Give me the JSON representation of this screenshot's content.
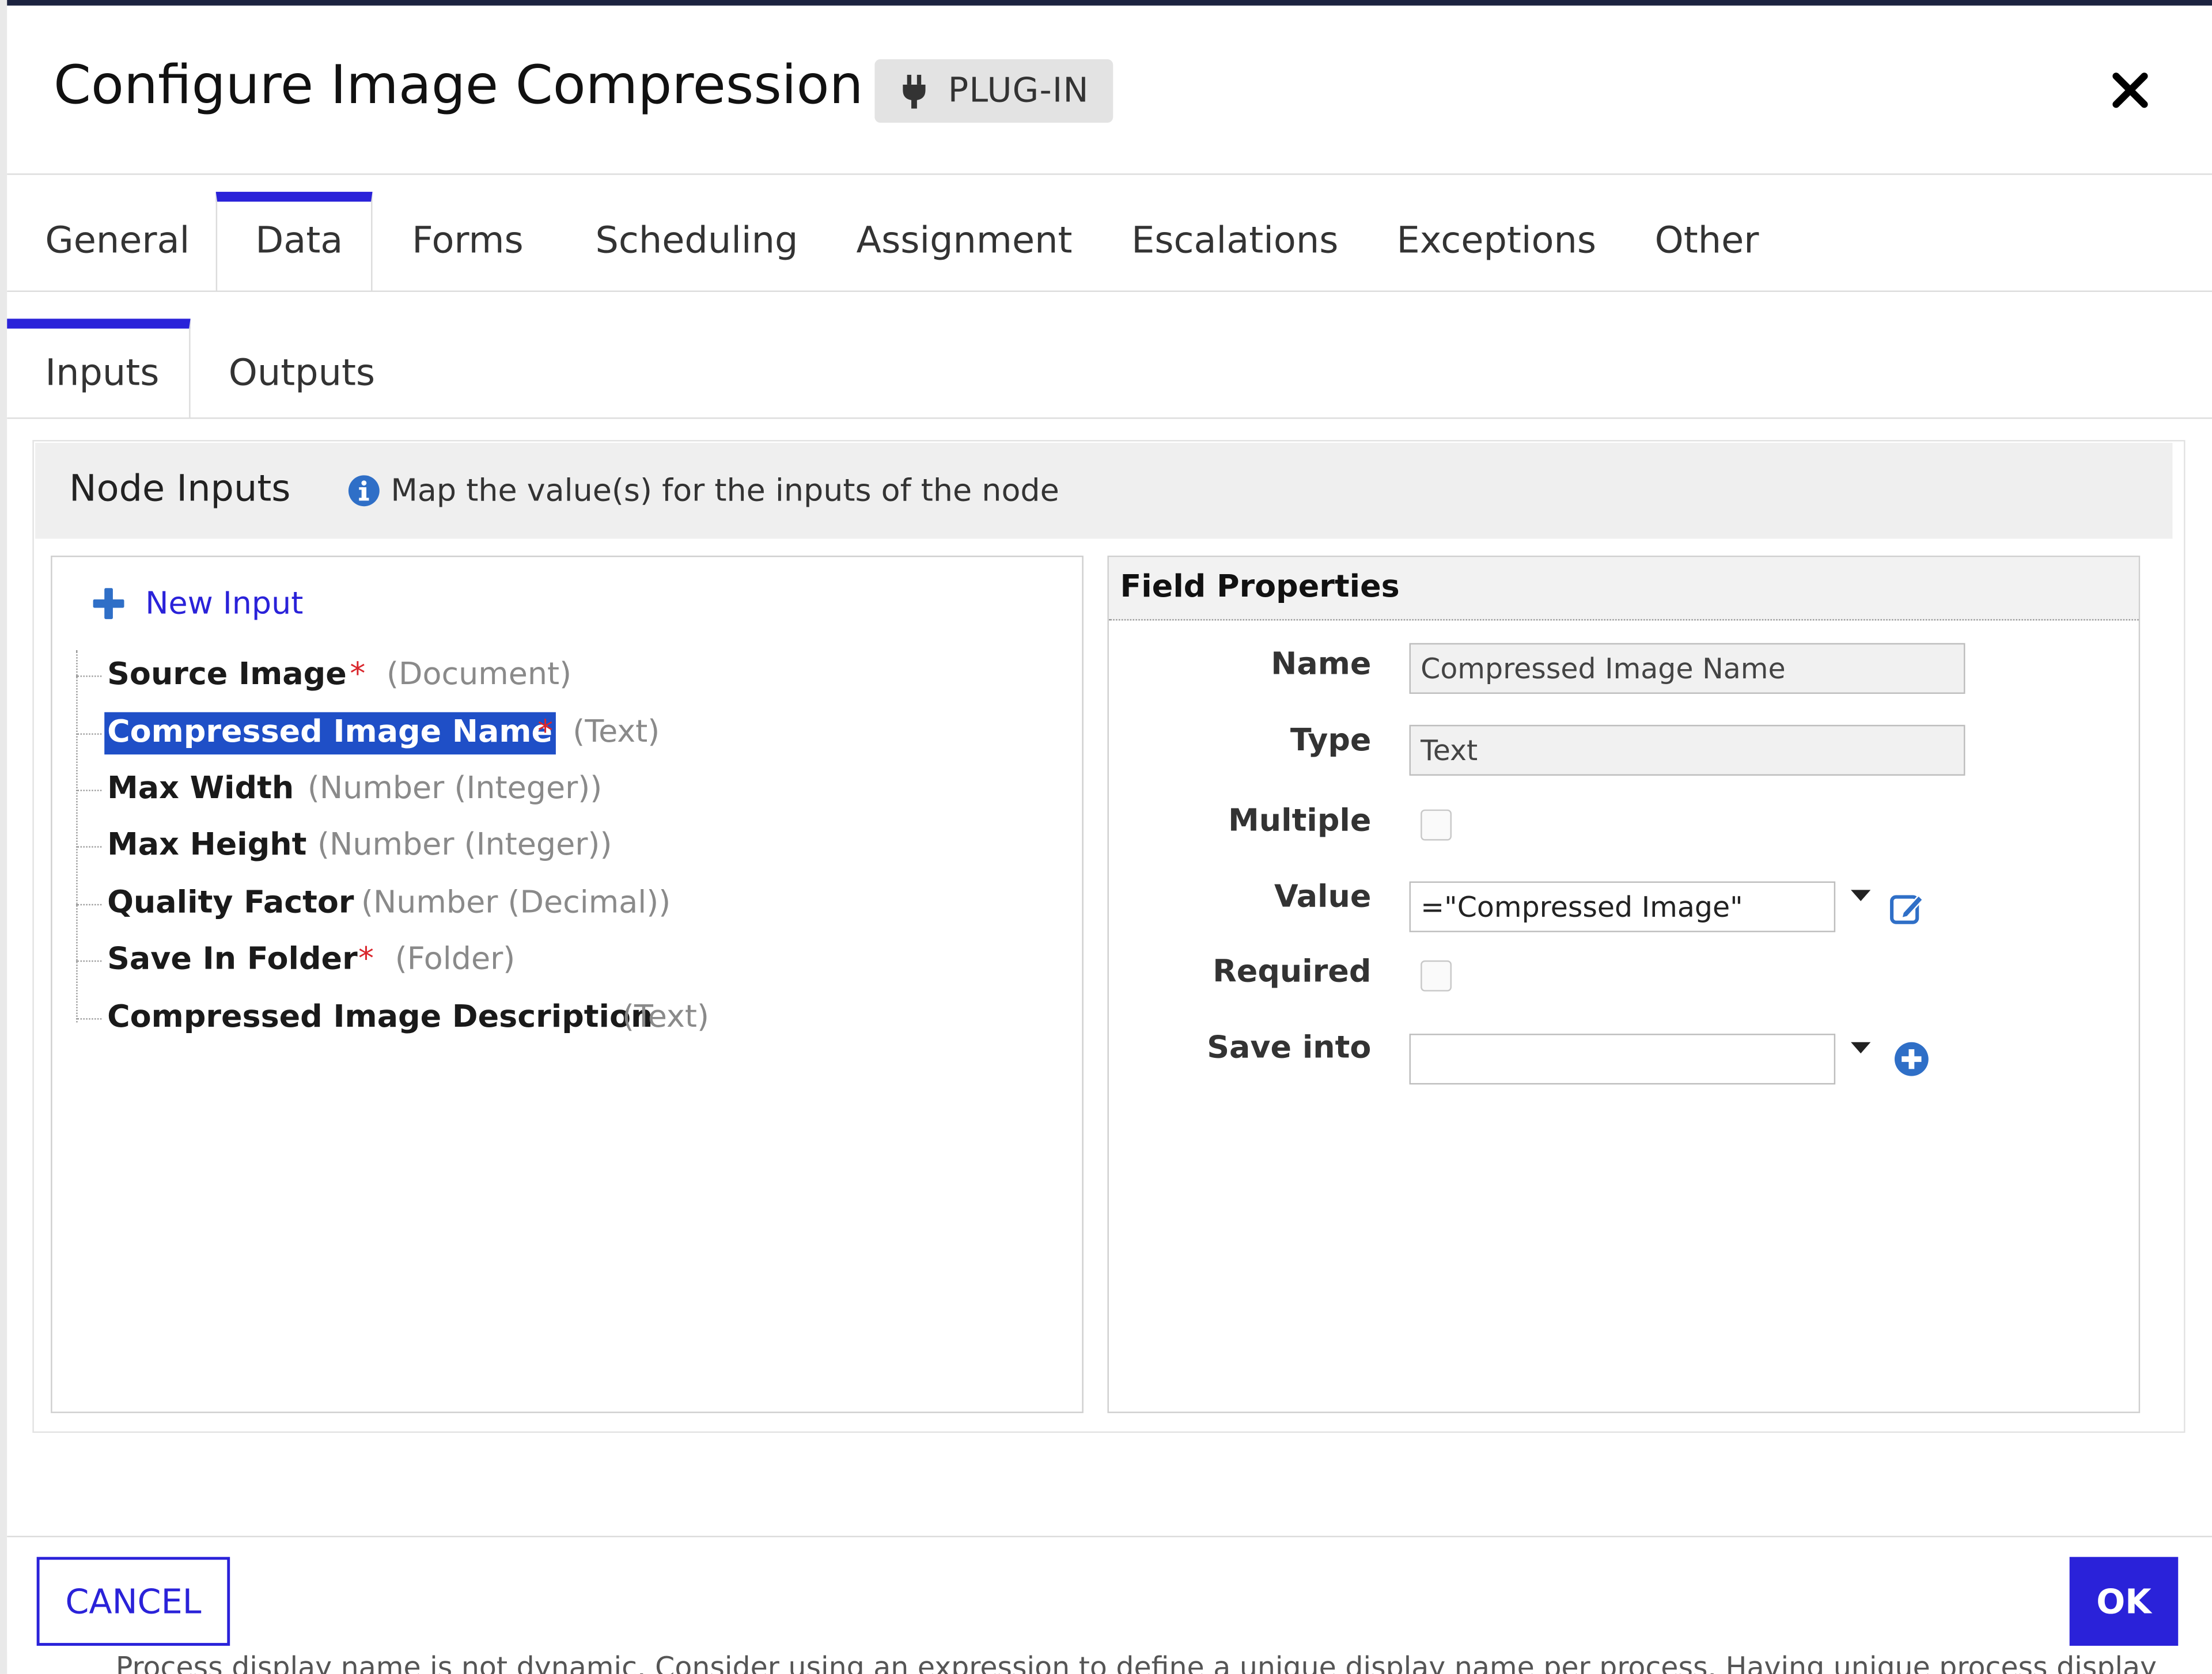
{
  "dialog": {
    "title": "Configure Image Compression",
    "badge": "PLUG-IN",
    "close_icon": "close-icon"
  },
  "tabs": [
    "General",
    "Data",
    "Forms",
    "Scheduling",
    "Assignment",
    "Escalations",
    "Exceptions",
    "Other"
  ],
  "active_tab": "Data",
  "subtabs": [
    "Inputs",
    "Outputs"
  ],
  "active_subtab": "Inputs",
  "node_inputs": {
    "title": "Node Inputs",
    "description": "Map the value(s) for the inputs of the node",
    "new_input_label": "New Input",
    "items": [
      {
        "name": "Source Image",
        "required": "*",
        "type": "(Document)"
      },
      {
        "name": "Compressed Image Name",
        "required": "*",
        "type": "(Text)"
      },
      {
        "name": "Max Width",
        "required": "",
        "type": "(Number (Integer))"
      },
      {
        "name": "Max Height",
        "required": "",
        "type": "(Number (Integer))"
      },
      {
        "name": "Quality Factor",
        "required": "",
        "type": "(Number (Decimal))"
      },
      {
        "name": "Save In Folder",
        "required": "*",
        "type": "(Folder)"
      },
      {
        "name": "Compressed Image Description",
        "required": "",
        "type": "(Text)"
      }
    ],
    "selected_item": "Compressed Image Name"
  },
  "field_properties": {
    "title": "Field Properties",
    "labels": {
      "name": "Name",
      "type": "Type",
      "multiple": "Multiple",
      "value": "Value",
      "required": "Required",
      "save_into": "Save into"
    },
    "name_value": "Compressed Image Name",
    "type_value": "Text",
    "multiple_checked": false,
    "value_expression": "=\"Compressed Image\"",
    "required_checked": false,
    "save_into_value": ""
  },
  "footer": {
    "cancel_label": "CANCEL",
    "ok_label": "OK"
  },
  "background_text": "Process display name is not dynamic. Consider using an expression to define a unique display name per process. Having unique process display",
  "colors": {
    "accent": "#2a22d9",
    "selection": "#1f4fc7",
    "required_star": "#d9262c",
    "info_icon": "#2f6fc7"
  }
}
